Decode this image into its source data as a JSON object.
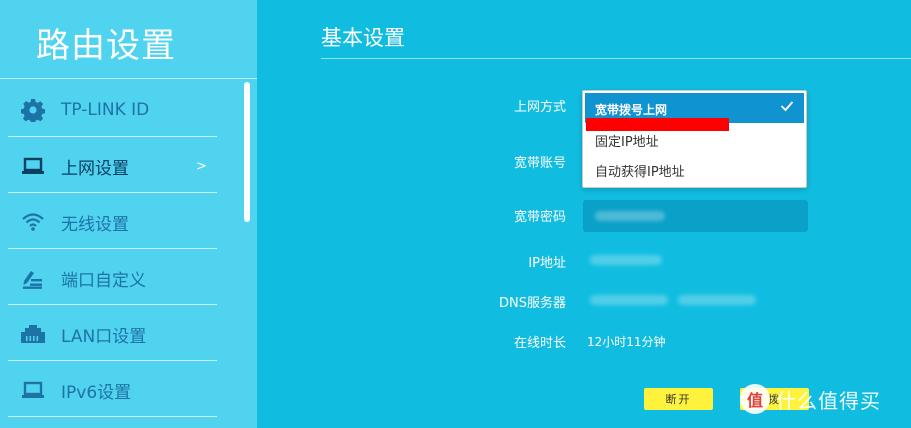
{
  "sidebar": {
    "title": "路由设置",
    "items": [
      {
        "label": "TP-LINK ID",
        "icon": "gear-icon"
      },
      {
        "label": "上网设置",
        "icon": "laptop-icon",
        "arrow": ">"
      },
      {
        "label": "无线设置",
        "icon": "wifi-icon"
      },
      {
        "label": "端口自定义",
        "icon": "edit-list-icon"
      },
      {
        "label": "LAN口设置",
        "icon": "lan-port-icon"
      },
      {
        "label": "IPv6设置",
        "icon": "laptop-icon"
      }
    ]
  },
  "main": {
    "title": "基本设置",
    "labels": {
      "connection_type": "上网方式",
      "account": "宽带账号",
      "password": "宽带密码",
      "ip": "IP地址",
      "dns": "DNS服务器",
      "online_time": "在线时长"
    },
    "online_time_value": "12小时11分钟",
    "dropdown": {
      "selected": "宽带拨号上网",
      "options": [
        "固定IP地址",
        "自动获得IP地址"
      ]
    },
    "buttons": {
      "disconnect": "断开",
      "connect": "拨"
    }
  },
  "watermark": {
    "badge": "值",
    "text": "什么值得买"
  },
  "colors": {
    "main_bg": "#10bde0",
    "sidebar_bg": "#4fd3ef",
    "nav_text": "#1e73a6",
    "dropdown_selected": "#1093d1",
    "button_yellow": "#fff23c",
    "redaction": "#ff0000"
  }
}
